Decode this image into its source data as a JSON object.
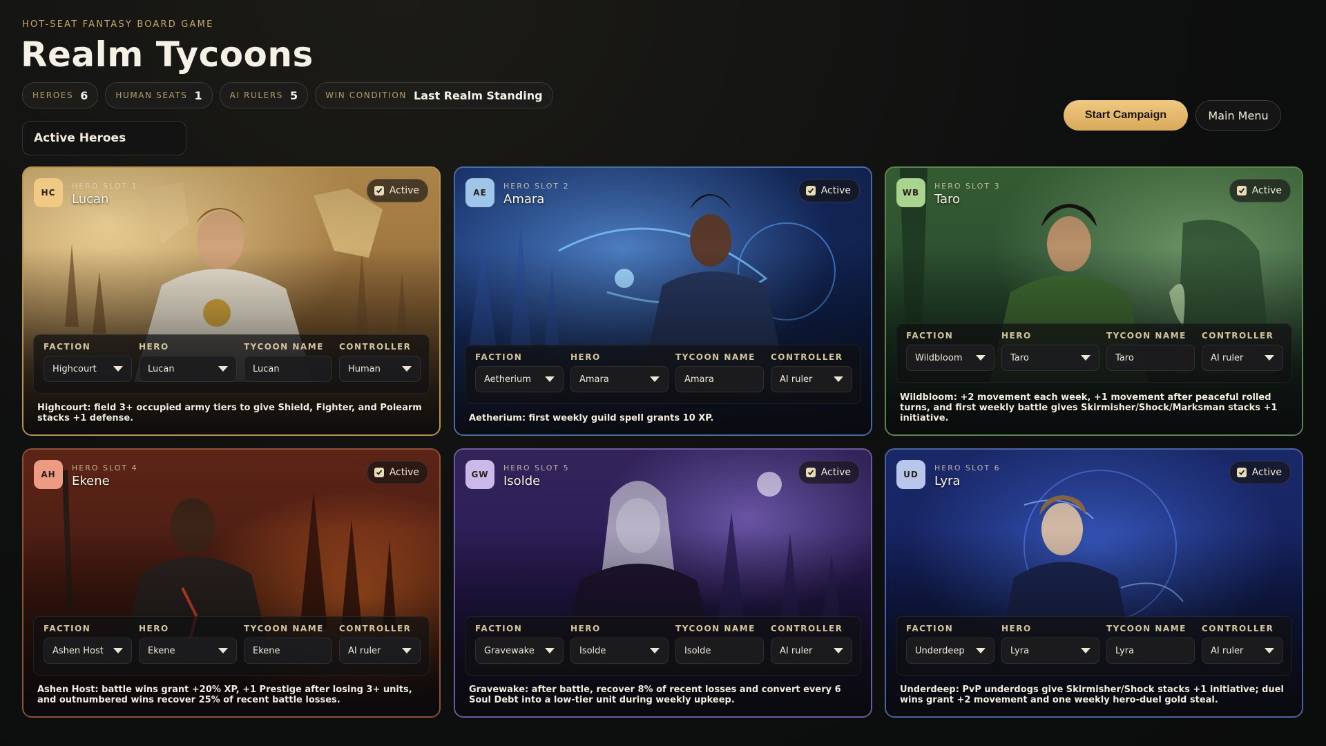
{
  "header": {
    "eyebrow": "HOT-SEAT FANTASY BOARD GAME",
    "title": "Realm Tycoons",
    "stats": [
      {
        "key": "HEROES",
        "value": "6"
      },
      {
        "key": "HUMAN SEATS",
        "value": "1"
      },
      {
        "key": "AI RULERS",
        "value": "5"
      },
      {
        "key": "WIN CONDITION",
        "value": "Last Realm Standing"
      }
    ],
    "section_label": "Active Heroes"
  },
  "actions": {
    "start": "Start Campaign",
    "menu": "Main Menu"
  },
  "field_labels": {
    "faction": "FACTION",
    "hero": "HERO",
    "tycoon": "TYCOON NAME",
    "controller": "CONTROLLER"
  },
  "cards": [
    {
      "initials": "HC",
      "slot": "HERO SLOT 1",
      "name": "Lucan",
      "active": "Active",
      "faction": "Highcourt",
      "hero": "Lucan",
      "tycoon": "Lucan",
      "controller": "Human",
      "desc": "Highcourt: field 3+ occupied army tiers to give Shield, Fighter, and Polearm stacks +1 defense.",
      "accent": "#c9a45a",
      "badge": "#f0c985"
    },
    {
      "initials": "AE",
      "slot": "HERO SLOT 2",
      "name": "Amara",
      "active": "Active",
      "faction": "Aetherium",
      "hero": "Amara",
      "tycoon": "Amara",
      "controller": "AI ruler",
      "desc": "Aetherium: first weekly guild spell grants 10 XP.",
      "accent": "#4f73b8",
      "badge": "#9fc6e8"
    },
    {
      "initials": "WB",
      "slot": "HERO SLOT 3",
      "name": "Taro",
      "active": "Active",
      "faction": "Wildbloom",
      "hero": "Taro",
      "tycoon": "Taro",
      "controller": "AI ruler",
      "desc": "Wildbloom: +2 movement each week, +1 movement after peaceful rolled turns, and first weekly battle gives Skirmisher/Shock/Marksman stacks +1 initiative.",
      "accent": "#5f8a55",
      "badge": "#a9d38f"
    },
    {
      "initials": "AH",
      "slot": "HERO SLOT 4",
      "name": "Ekene",
      "active": "Active",
      "faction": "Ashen Host",
      "hero": "Ekene",
      "tycoon": "Ekene",
      "controller": "AI ruler",
      "desc": "Ashen Host: battle wins grant +20% XP, +1 Prestige after losing 3+ units, and outnumbered wins recover 25% of recent battle losses.",
      "accent": "#9a5a3e",
      "badge": "#ee9b84"
    },
    {
      "initials": "GW",
      "slot": "HERO SLOT 5",
      "name": "Isolde",
      "active": "Active",
      "faction": "Gravewake",
      "hero": "Isolde",
      "tycoon": "Isolde",
      "controller": "AI ruler",
      "desc": "Gravewake: after battle, recover 8% of recent losses and convert every 6 Soul Debt into a low-tier unit during weekly upkeep.",
      "accent": "#7560a8",
      "badge": "#cbb9ea"
    },
    {
      "initials": "UD",
      "slot": "HERO SLOT 6",
      "name": "Lyra",
      "active": "Active",
      "faction": "Underdeep",
      "hero": "Lyra",
      "tycoon": "Lyra",
      "controller": "AI ruler",
      "desc": "Underdeep: PvP underdogs give Skirmisher/Shock stacks +1 initiative; duel wins grant +2 movement and one weekly hero-duel gold steal.",
      "accent": "#5066a8",
      "badge": "#b9c6ec"
    }
  ]
}
